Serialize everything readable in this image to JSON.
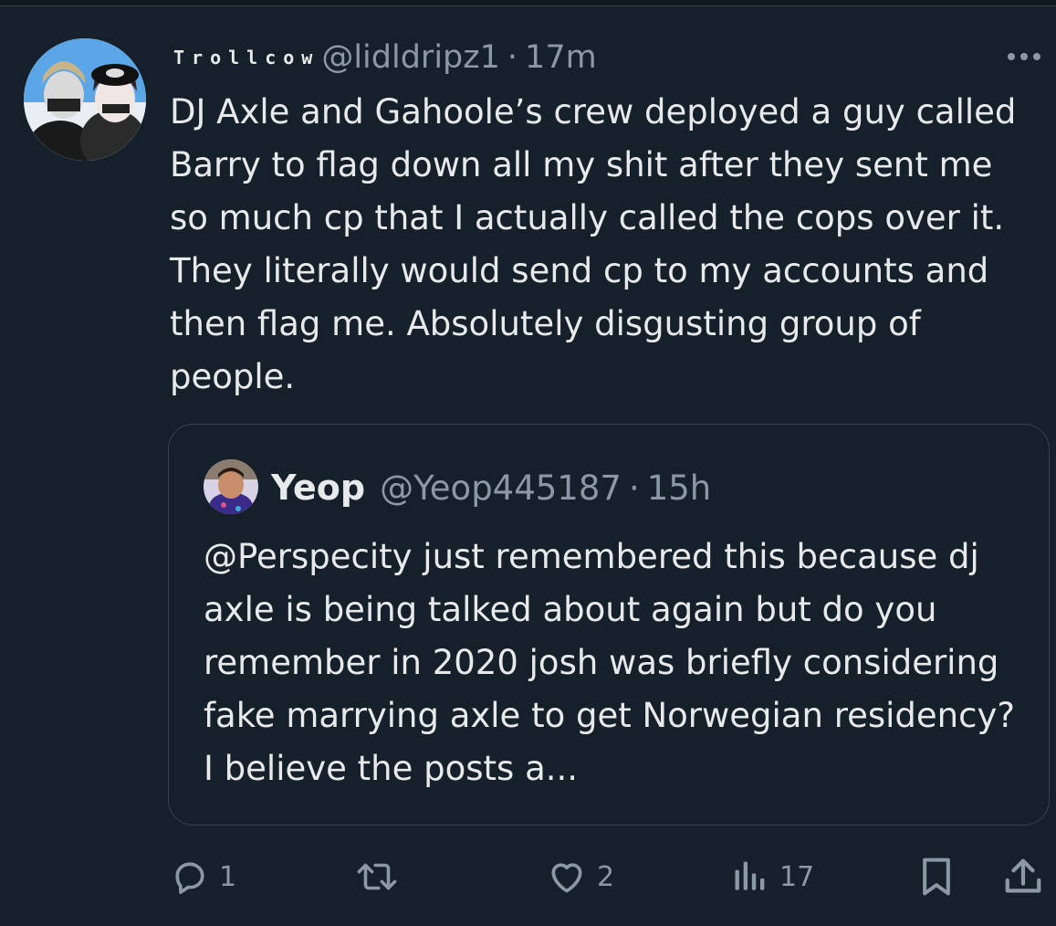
{
  "tweet": {
    "display_name": "Trollcow",
    "handle": "@lidldripz1",
    "separator": "·",
    "time": "17m",
    "text": "DJ Axle and Gahoole’s crew deployed a guy called Barry to flag down all my shit after they sent me so much cp that I actually called the cops over it. They literally would send cp to my accounts and then flag me. Absolutely disgusting group of people."
  },
  "quoted": {
    "display_name": "Yeop",
    "handle": "@Yeop445187",
    "separator": "·",
    "time": "15h",
    "text": "@Perspecity just remembered this because dj axle is being talked about again but do you remember in 2020 josh was briefly considering fake marrying axle to get Norwegian residency? I believe the posts a..."
  },
  "actions": {
    "reply_count": "1",
    "like_count": "2",
    "views_count": "17",
    "icons": [
      "reply-icon",
      "retweet-icon",
      "like-icon",
      "views-icon",
      "bookmark-icon",
      "share-icon"
    ]
  },
  "colors": {
    "background": "#15202b",
    "text": "#e7e9ea",
    "secondary": "#8b98a5",
    "border": "#38444d"
  }
}
